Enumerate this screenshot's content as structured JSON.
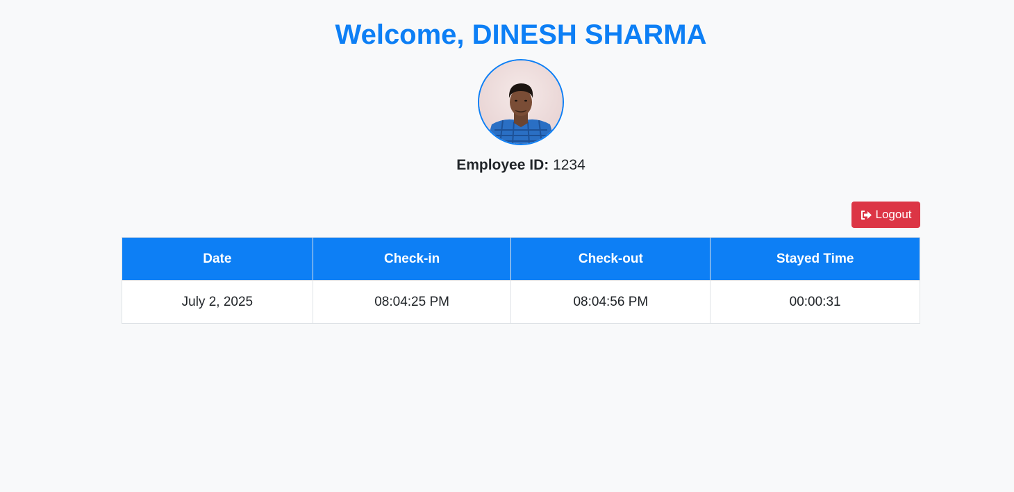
{
  "header": {
    "welcome": "Welcome, DINESH SHARMA"
  },
  "profile": {
    "employee_id_label": "Employee ID:",
    "employee_id_value": "1234"
  },
  "actions": {
    "logout_label": "Logout"
  },
  "attendance": {
    "columns": [
      "Date",
      "Check-in",
      "Check-out",
      "Stayed Time"
    ],
    "rows": [
      [
        "July 2, 2025",
        "08:04:25 PM",
        "08:04:56 PM",
        "00:00:31"
      ]
    ]
  },
  "colors": {
    "primary": "#0d7ff5",
    "danger": "#dc3545",
    "background": "#f8f9fa"
  },
  "icons": {
    "logout": "sign-out-icon"
  }
}
